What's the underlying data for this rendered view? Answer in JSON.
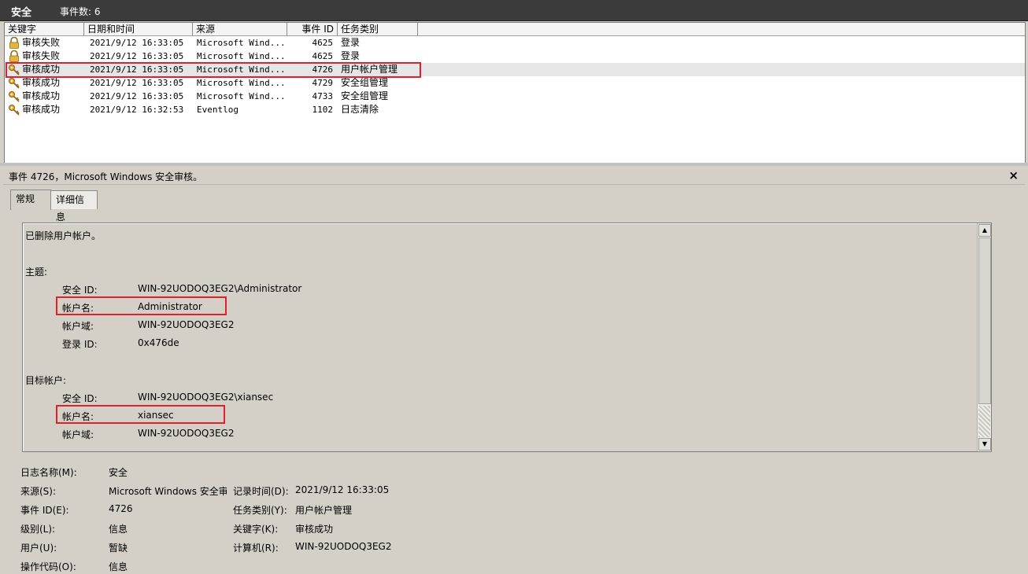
{
  "titlebar": {
    "title": "安全",
    "event_count": "事件数: 6"
  },
  "list": {
    "columns": [
      "关键字",
      "日期和时间",
      "来源",
      "事件 ID",
      "任务类别"
    ],
    "rows": [
      {
        "keyword": "审核失败",
        "datetime": "2021/9/12 16:33:05",
        "source": "Microsoft Wind...",
        "event_id": "4625",
        "task": "登录",
        "icon": "lock-icon"
      },
      {
        "keyword": "审核失败",
        "datetime": "2021/9/12 16:33:05",
        "source": "Microsoft Wind...",
        "event_id": "4625",
        "task": "登录",
        "icon": "lock-icon"
      },
      {
        "keyword": "审核成功",
        "datetime": "2021/9/12 16:33:05",
        "source": "Microsoft Wind...",
        "event_id": "4726",
        "task": "用户帐户管理",
        "icon": "key-icon",
        "selected": true
      },
      {
        "keyword": "审核成功",
        "datetime": "2021/9/12 16:33:05",
        "source": "Microsoft Wind...",
        "event_id": "4729",
        "task": "安全组管理",
        "icon": "key-icon"
      },
      {
        "keyword": "审核成功",
        "datetime": "2021/9/12 16:33:05",
        "source": "Microsoft Wind...",
        "event_id": "4733",
        "task": "安全组管理",
        "icon": "key-icon"
      },
      {
        "keyword": "审核成功",
        "datetime": "2021/9/12 16:32:53",
        "source": "Eventlog",
        "event_id": "1102",
        "task": "日志清除",
        "icon": "key-icon"
      }
    ]
  },
  "detail": {
    "header": "事件 4726，Microsoft Windows 安全审核。",
    "close": "×",
    "tabs": [
      "常规",
      "详细信息"
    ],
    "description": {
      "summary": "已删除用户帐户。",
      "subject_heading": "主题:",
      "subject": {
        "sid_label": "安全 ID:",
        "sid_value": "WIN-92UODOQ3EG2\\Administrator",
        "account_label": "帐户名:",
        "account_value": "Administrator",
        "domain_label": "帐户域:",
        "domain_value": "WIN-92UODOQ3EG2",
        "logon_label": "登录 ID:",
        "logon_value": "0x476de"
      },
      "target_heading": "目标帐户:",
      "target": {
        "sid_label": "安全 ID:",
        "sid_value": "WIN-92UODOQ3EG2\\xiansec",
        "account_label": "帐户名:",
        "account_value": "xiansec",
        "domain_label": "帐户域:",
        "domain_value": "WIN-92UODOQ3EG2"
      }
    },
    "props": {
      "log_name_label": "日志名称(M):",
      "log_name": "安全",
      "source_label": "来源(S):",
      "source": "Microsoft Windows 安全审",
      "event_id_label": "事件 ID(E):",
      "event_id": "4726",
      "level_label": "级别(L):",
      "level": "信息",
      "user_label": "用户(U):",
      "user": "暂缺",
      "opcode_label": "操作代码(O):",
      "opcode": "信息",
      "logged_label": "记录时间(D):",
      "logged": "2021/9/12 16:33:05",
      "task_label": "任务类别(Y):",
      "task": "用户帐户管理",
      "keywords_label": "关键字(K):",
      "keywords": "审核成功",
      "computer_label": "计算机(R):",
      "computer": "WIN-92UODOQ3EG2"
    }
  },
  "colors": {
    "highlight_border": "#e0202a",
    "title_bg": "#3b3b3b",
    "panel_bg": "#d4d0c8"
  }
}
